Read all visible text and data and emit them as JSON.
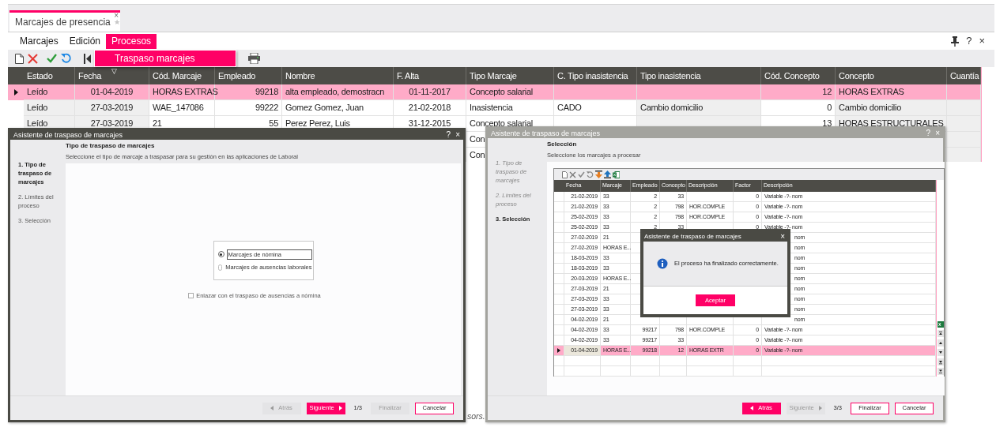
{
  "main_window": {
    "tab": {
      "title": "Marcajes de presencia",
      "selected": true,
      "close": "×"
    },
    "menu": [
      {
        "label": "Marcajes",
        "selected": false
      },
      {
        "label": "Edición",
        "selected": false
      },
      {
        "label": "Procesos",
        "selected": true
      }
    ],
    "window_buttons": [
      "?",
      "×"
    ],
    "dropdown": [
      {
        "label": "Traspaso marcajes",
        "selected": true
      }
    ],
    "grid": {
      "columns": [
        {
          "label": "Estado"
        },
        {
          "label": "Fecha",
          "sort_mark": "▽"
        },
        {
          "label": "Cód. Marcaje"
        },
        {
          "label": "Empleado"
        },
        {
          "label": "Nombre"
        },
        {
          "label": "F. Alta"
        },
        {
          "label": "Tipo Marcaje"
        },
        {
          "label": "C. Tipo inasistencia"
        },
        {
          "label": "Tipo inasistencia"
        },
        {
          "label": "Cód. Concepto"
        },
        {
          "label": "Concepto"
        },
        {
          "label": "Cuantía"
        }
      ],
      "rows": [
        {
          "selected": true,
          "cells": [
            "Leído",
            "01-04-2019",
            "HORAS EXTRAS",
            "99218",
            "alta empleado, demostracn",
            "01-11-2017",
            "Concepto salarial",
            null,
            null,
            "12",
            "HORAS EXTRAS",
            null
          ]
        },
        {
          "selected": false,
          "cells": [
            "Leído",
            "27-03-2019",
            "WAE_147086",
            "99222",
            "Gomez Gomez, Juan",
            "21-02-2018",
            "Inasistencia",
            "CADO",
            "Cambio domicilio",
            "0",
            "Cambio domicilio",
            null
          ]
        },
        {
          "selected": false,
          "cells": [
            "Leído",
            "27-03-2019",
            "21",
            "55",
            "Perez Perez, Luis",
            "31-12-2015",
            "Concepto salarial",
            null,
            null,
            "13",
            "HORAS ESTRUCTURALES",
            null
          ]
        },
        {
          "selected": false,
          "cells": [
            null,
            null,
            null,
            null,
            null,
            null,
            "Con",
            null,
            null,
            null,
            null,
            null
          ]
        },
        {
          "selected": false,
          "cells": [
            null,
            null,
            null,
            null,
            null,
            null,
            "Con",
            null,
            null,
            null,
            null,
            null
          ]
        }
      ]
    }
  },
  "background_text": "sors.",
  "wizard_type": {
    "title": "Asistente de traspaso de marcajes",
    "title_buttons": [
      "?",
      "×"
    ],
    "steps": [
      {
        "label": "1. Tipo de traspaso de marcajes",
        "selected": true,
        "completed": false
      },
      {
        "label": "2. Límites del proceso",
        "selected": false,
        "completed": false
      },
      {
        "label": "3. Selección",
        "selected": false,
        "completed": false
      }
    ],
    "heading": "Tipo de traspaso de marcajes",
    "subheading": "Seleccione el tipo de marcaje a traspasar para su gestión en las aplicaciones de Laboral",
    "options": [
      {
        "label": "Marcajes de nómina",
        "selected": true
      },
      {
        "label": "Marcajes de ausencias laborales",
        "selected": false
      }
    ],
    "checkbox": {
      "label": "Enlazar con el traspaso de ausencias a nómina",
      "checked": false
    },
    "buttons": [
      {
        "label": "Atrás",
        "kind": "disabled"
      },
      {
        "label": "Siguiente",
        "kind": "primary"
      }
    ],
    "page": "1/3",
    "end_buttons": [
      {
        "label": "Finalizar",
        "kind": "disabled"
      },
      {
        "label": "Cancelar",
        "kind": "outline"
      }
    ]
  },
  "wizard_selection": {
    "title": "Asistente de traspaso de marcajes",
    "title_buttons": [
      "?",
      "×"
    ],
    "steps": [
      {
        "label": "1. Tipo de traspaso de marcajes",
        "selected": false,
        "completed": true
      },
      {
        "label": "2. Límites del proceso",
        "selected": false,
        "completed": true
      },
      {
        "label": "3. Selección",
        "selected": true,
        "completed": false
      }
    ],
    "heading": "Selección",
    "subheading": "Seleccione los marcajes a procesar",
    "table": {
      "columns": [
        "Fecha",
        "Marcaje",
        "Empleado",
        "Concepto",
        "Descripción",
        "Factor",
        "Descripción"
      ],
      "rows": [
        {
          "kind": "full",
          "selected": false,
          "cells": [
            "21-02-2019",
            "33",
            "2",
            "33",
            null,
            "0",
            "Variable -?- nom"
          ]
        },
        {
          "kind": "full",
          "selected": false,
          "cells": [
            "21-02-2019",
            "33",
            "2",
            "798",
            "HOR.COMPLE",
            "0",
            "Variable -?- nom"
          ]
        },
        {
          "kind": "full",
          "selected": false,
          "cells": [
            "25-02-2019",
            "33",
            "2",
            "798",
            "HOR.COMPLE",
            "0",
            "Variable -?- nom"
          ]
        },
        {
          "kind": "full",
          "selected": false,
          "cells": [
            "25-02-2019",
            "33",
            "2",
            "33",
            null,
            "0",
            "Variable -?- nom"
          ]
        },
        {
          "kind": "covered",
          "selected": false,
          "cells": [
            "27-02-2019",
            "21",
            null,
            null,
            null,
            null,
            "nom"
          ]
        },
        {
          "kind": "covered",
          "selected": false,
          "cells": [
            "27-02-2019",
            "HORAS E...",
            null,
            null,
            null,
            null,
            "nom"
          ]
        },
        {
          "kind": "covered",
          "selected": false,
          "cells": [
            "18-03-2019",
            "33",
            null,
            null,
            null,
            null,
            "nom"
          ]
        },
        {
          "kind": "covered",
          "selected": false,
          "cells": [
            "18-03-2019",
            "33",
            null,
            null,
            null,
            null,
            "nom"
          ]
        },
        {
          "kind": "covered",
          "selected": false,
          "cells": [
            "20-03-2019",
            "HORAS E...",
            null,
            null,
            null,
            null,
            "nom"
          ]
        },
        {
          "kind": "covered",
          "selected": false,
          "cells": [
            "27-03-2019",
            "21",
            null,
            null,
            null,
            null,
            "nom"
          ]
        },
        {
          "kind": "covered",
          "selected": false,
          "cells": [
            "27-03-2019",
            "33",
            null,
            null,
            null,
            null,
            "nom"
          ]
        },
        {
          "kind": "covered",
          "selected": false,
          "cells": [
            "27-03-2019",
            "33",
            null,
            null,
            null,
            null,
            "nom"
          ]
        },
        {
          "kind": "covered",
          "selected": false,
          "cells": [
            "04-02-2019",
            "21",
            null,
            null,
            null,
            null,
            "nom"
          ]
        },
        {
          "kind": "full",
          "selected": false,
          "cells": [
            "04-02-2019",
            "33",
            "99217",
            "798",
            "HOR.COMPLE",
            "0",
            "Variable -?- nom"
          ]
        },
        {
          "kind": "full",
          "selected": false,
          "cells": [
            "04-02-2019",
            "33",
            "99217",
            "33",
            null,
            "0",
            "Variable -?- nom"
          ]
        },
        {
          "kind": "full",
          "selected": true,
          "cells": [
            "01-04-2019",
            "HORAS E...",
            "99218",
            "12",
            "HORAS EXTR",
            "0",
            "Variable -?- nom"
          ]
        }
      ]
    },
    "buttons": [
      {
        "label": "Atrás",
        "kind": "primary"
      },
      {
        "label": "Siguiente",
        "kind": "disabled"
      }
    ],
    "page": "3/3",
    "end_buttons": [
      {
        "label": "Finalizar",
        "kind": "outline"
      },
      {
        "label": "Cancelar",
        "kind": "outline"
      }
    ]
  },
  "message_box": {
    "title": "Asistente de traspaso de marcajes",
    "close": "×",
    "message": "El proceso ha finalizado correctamente.",
    "button": "Aceptar"
  }
}
